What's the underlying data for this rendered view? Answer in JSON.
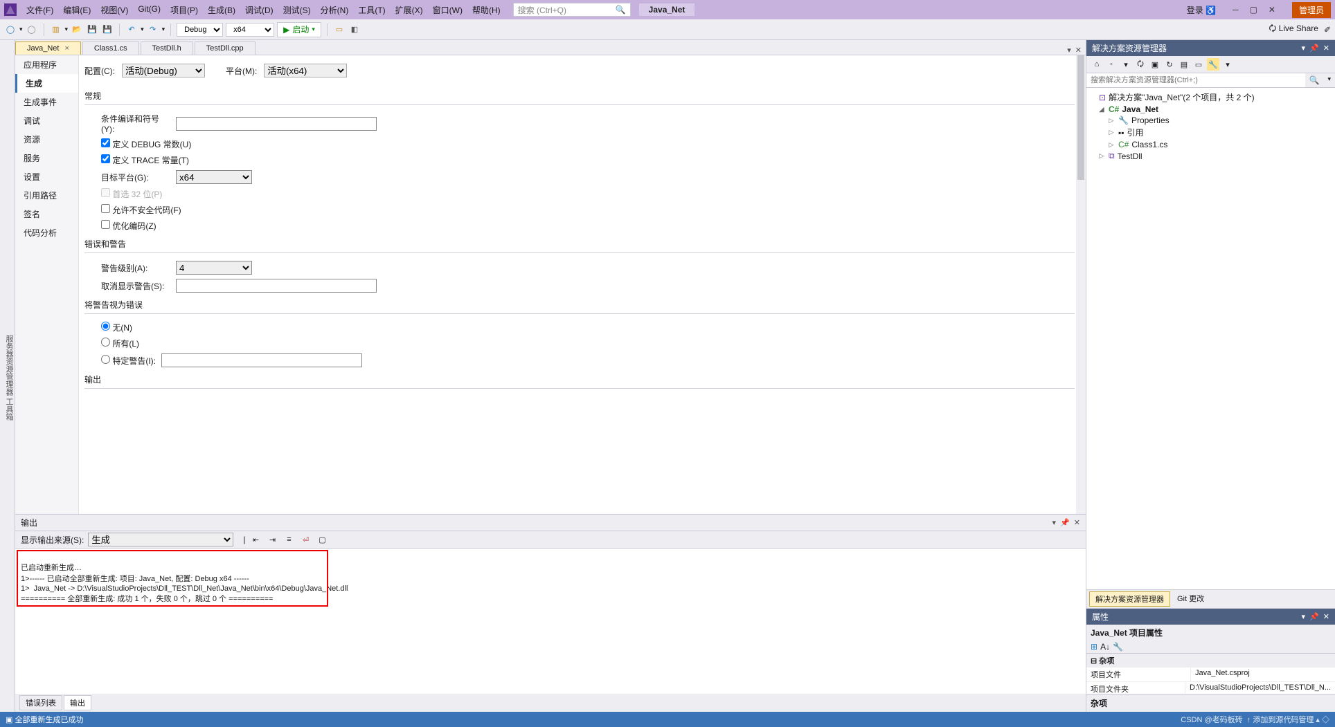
{
  "menu": {
    "file": "文件(F)",
    "edit": "编辑(E)",
    "view": "视图(V)",
    "git": "Git(G)",
    "project": "项目(P)",
    "build": "生成(B)",
    "debug": "调试(D)",
    "test": "测试(S)",
    "analyze": "分析(N)",
    "tools": "工具(T)",
    "extensions": "扩展(X)",
    "window": "窗口(W)",
    "help": "帮助(H)"
  },
  "title_app": "Java_Net",
  "search_placeholder": "搜索 (Ctrl+Q)",
  "login": "登录",
  "admin": "管理员",
  "live_share": "Live Share",
  "toolbar": {
    "config": "Debug",
    "platform": "x64",
    "start": "启动"
  },
  "doc_tabs": [
    "Java_Net",
    "Class1.cs",
    "TestDll.h",
    "TestDll.cpp"
  ],
  "prop_sidebar": [
    "应用程序",
    "生成",
    "生成事件",
    "调试",
    "资源",
    "服务",
    "设置",
    "引用路径",
    "签名",
    "代码分析"
  ],
  "prop_sidebar_sel": 1,
  "cfg": {
    "config_lbl": "配置(C):",
    "config_val": "活动(Debug)",
    "platform_lbl": "平台(M):",
    "platform_val": "活动(x64)"
  },
  "sec_general": "常规",
  "form": {
    "cond_sym": "条件编译和符号(Y):",
    "debug_const": "定义 DEBUG 常数(U)",
    "trace_const": "定义 TRACE 常量(T)",
    "target_plat": "目标平台(G):",
    "target_plat_val": "x64",
    "prefer32": "首选 32 位(P)",
    "unsafe": "允许不安全代码(F)",
    "optimize": "优化编码(Z)"
  },
  "sec_errwarn": "错误和警告",
  "warn": {
    "level_lbl": "警告级别(A):",
    "level_val": "4",
    "suppress_lbl": "取消显示警告(S):"
  },
  "sec_treat": "将警告视为错误",
  "treat": {
    "none": "无(N)",
    "all": "所有(L)",
    "specific": "特定警告(I):"
  },
  "sec_output": "输出",
  "output": {
    "title": "输出",
    "src_lbl": "显示输出来源(S):",
    "src_val": "生成",
    "lines": [
      "已启动重新生成…",
      "1>------ 已启动全部重新生成: 项目: Java_Net, 配置: Debug x64 ------",
      "1>  Java_Net -> D:\\VisualStudioProjects\\Dll_TEST\\Dll_Net\\Java_Net\\bin\\x64\\Debug\\Java_Net.dll",
      "========== 全部重新生成: 成功 1 个，失败 0 个，跳过 0 个 =========="
    ]
  },
  "bottom_tabs": {
    "errors": "错误列表",
    "output": "输出"
  },
  "sol": {
    "title": "解决方案资源管理器",
    "search_ph": "搜索解决方案资源管理器(Ctrl+;)",
    "root": "解决方案\"Java_Net\"(2 个项目，共 2 个)",
    "proj1": "Java_Net",
    "p1_props": "Properties",
    "p1_refs": "引用",
    "p1_class": "Class1.cs",
    "proj2": "TestDll",
    "tab1": "解决方案资源管理器",
    "tab2": "Git 更改"
  },
  "props": {
    "title": "属性",
    "obj": "Java_Net 项目属性",
    "cat": "杂项",
    "k1": "项目文件",
    "v1": "Java_Net.csproj",
    "k2": "项目文件夹",
    "v2": "D:\\VisualStudioProjects\\Dll_TEST\\Dll_N...",
    "desc": "杂项"
  },
  "status": {
    "left": "全部重新生成已成功",
    "right": "↑ 添加到源代码管理 ▴   ◇"
  },
  "watermark": "CSDN @老码板砖"
}
